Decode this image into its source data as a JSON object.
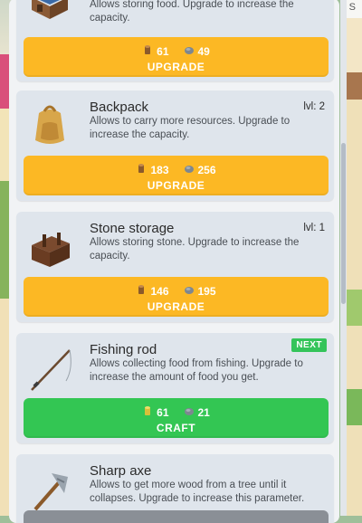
{
  "right_edge_text": "S",
  "cards": [
    {
      "icon": "house-icon",
      "title": "",
      "level": "",
      "description": "Allows storing food. Upgrade to increase the capacity.",
      "cost_wood": "61",
      "cost_stone": "49",
      "button": "UPGRADE",
      "button_color": "#fcb824"
    },
    {
      "icon": "backpack-icon",
      "title": "Backpack",
      "level": "lvl: 2",
      "description": "Allows to carry more resources. Upgrade to increase the capacity.",
      "cost_wood": "183",
      "cost_stone": "256",
      "button": "UPGRADE",
      "button_color": "#fcb824"
    },
    {
      "icon": "stone-storage-icon",
      "title": "Stone storage",
      "level": "lvl: 1",
      "description": "Allows storing stone. Upgrade to increase the capacity.",
      "cost_wood": "146",
      "cost_stone": "195",
      "button": "UPGRADE",
      "button_color": "#fcb824"
    },
    {
      "icon": "fishing-rod-icon",
      "title": "Fishing rod",
      "badge": "NEXT",
      "description": "Allows collecting food from fishing. Upgrade to increase the amount of food you get.",
      "cost_wood": "61",
      "cost_stone": "21",
      "button": "CRAFT",
      "button_color": "#33c653"
    },
    {
      "icon": "axe-icon",
      "title": "Sharp axe",
      "description": "Allows to get more wood from a tree until it collapses. Upgrade to increase this parameter."
    }
  ]
}
